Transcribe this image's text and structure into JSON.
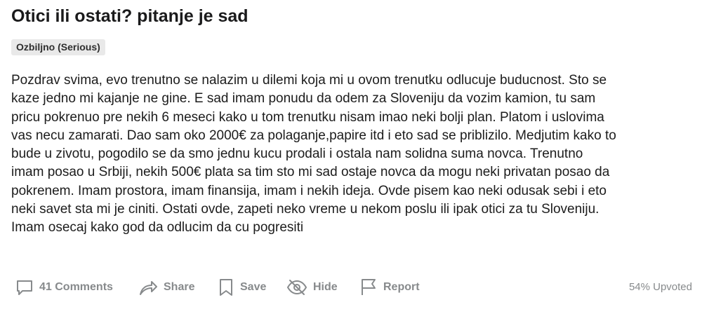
{
  "post": {
    "title": "Otici ili ostati? pitanje je sad",
    "flair": "Ozbiljno (Serious)",
    "body_lines": [
      "Pozdrav svima, evo trenutno se nalazim u dilemi koja mi u ovom trenutku odlucuje buducnost. Sto se",
      "kaze jedno mi kajanje ne gine. E sad imam ponudu da odem za Sloveniju da vozim kamion, tu sam",
      "pricu pokrenuo pre nekih 6 meseci kako u tom trenutku nisam imao neki bolji plan. Platom i uslovima",
      "vas necu zamarati. Dao sam oko 2000€ za polaganje,papire itd i eto sad se priblizilo. Medjutim kako to",
      "bude u zivotu, pogodilo se da smo jednu kucu prodali i ostala nam solidna suma novca. Trenutno",
      "imam posao u Srbiji, nekih 500€ plata sa tim sto mi sad ostaje novca da mogu neki privatan posao da",
      "pokrenem. Imam prostora, imam finansija, imam i nekih ideja. Ovde pisem kao neki odusak sebi i eto",
      "neki savet sta mi je ciniti. Ostati ovde, zapeti neko vreme u nekom poslu ili ipak otici za tu Sloveniju.",
      "Imam osecaj kako god da odlucim da cu pogresiti"
    ]
  },
  "actions": {
    "comments": {
      "label": "41 Comments",
      "icon": "comment-icon"
    },
    "share": {
      "label": "Share",
      "icon": "share-icon"
    },
    "save": {
      "label": "Save",
      "icon": "bookmark-icon"
    },
    "hide": {
      "label": "Hide",
      "icon": "eye-slash-icon"
    },
    "report": {
      "label": "Report",
      "icon": "flag-icon"
    }
  },
  "stats": {
    "upvoted": "54% Upvoted"
  },
  "colors": {
    "text": "#1c1c1c",
    "meta": "#878a8c",
    "flair_bg": "#e9e9e9"
  }
}
